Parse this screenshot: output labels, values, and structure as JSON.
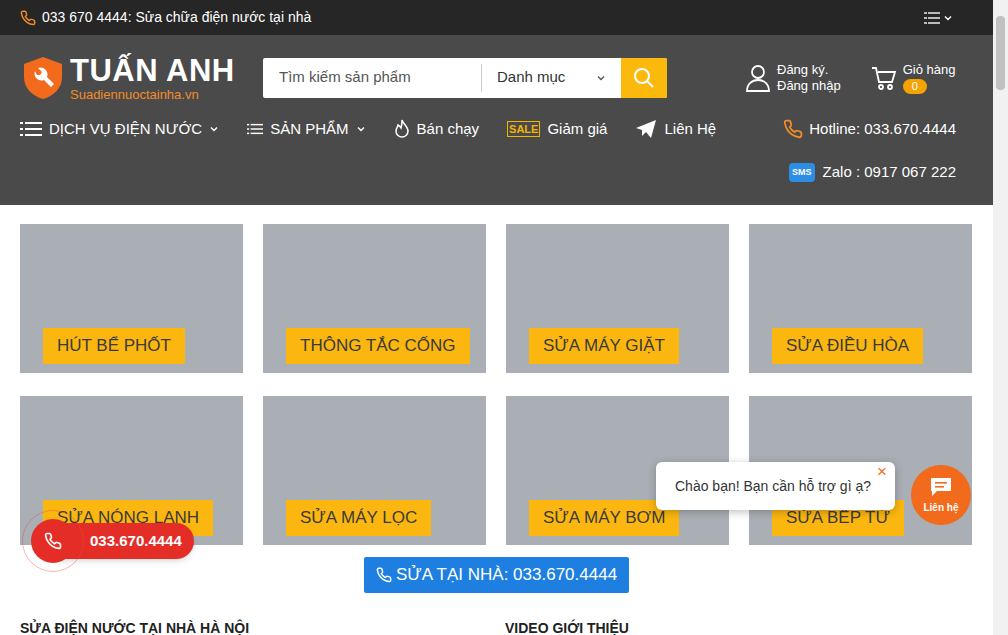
{
  "topbar": {
    "text": "033 670 4444: Sửa chữa điện nước tại nhà"
  },
  "logo": {
    "title": "TUẤN ANH",
    "subtitle": "Suadiennuoctainha.vn"
  },
  "search": {
    "placeholder": "Tìm kiếm sản phẩm",
    "category": "Danh mục"
  },
  "account": {
    "register": "Đăng ký.",
    "login": "Đăng nhập"
  },
  "cart": {
    "label": "Giỏ hàng",
    "count": "0"
  },
  "nav": [
    {
      "label": "DỊCH VỤ ĐIỆN NƯỚC",
      "kind": "menu"
    },
    {
      "label": "SẢN PHẨM",
      "kind": "menu"
    },
    {
      "label": "Bán chạy",
      "kind": "link"
    },
    {
      "label": "Giảm giá",
      "kind": "sale",
      "icon_text": "SALE"
    },
    {
      "label": "Liên Hệ",
      "kind": "link"
    }
  ],
  "hotline": "Hotline: 033.670.4444",
  "zalo": {
    "icon_text": "SMS",
    "label": "Zalo : 0917 067 222"
  },
  "services": [
    {
      "label": "HÚT BỂ PHỐT"
    },
    {
      "label": "THÔNG TẮC CỐNG"
    },
    {
      "label": "SỬA MÁY GIẶT"
    },
    {
      "label": "SỬA ĐIỀU HÒA"
    },
    {
      "label": "SỬA NÓNG LANH"
    },
    {
      "label": "SỬA MÁY LỌC"
    },
    {
      "label": "SỬA MÁY BƠM"
    },
    {
      "label": "SỬA BẾP TỪ"
    }
  ],
  "cta": "SỬA TẠI NHÀ: 033.670.4444",
  "sections": [
    "SỬA ĐIỆN NƯỚC TẠI NHÀ HÀ NỘI",
    "VIDEO GIỚI THIỆU"
  ],
  "float_phone": "033.670.4444",
  "chat": {
    "message": "Chào bạn! Bạn cần hỗ trợ gì ạ?",
    "close": "×",
    "button": "Liên hệ"
  }
}
